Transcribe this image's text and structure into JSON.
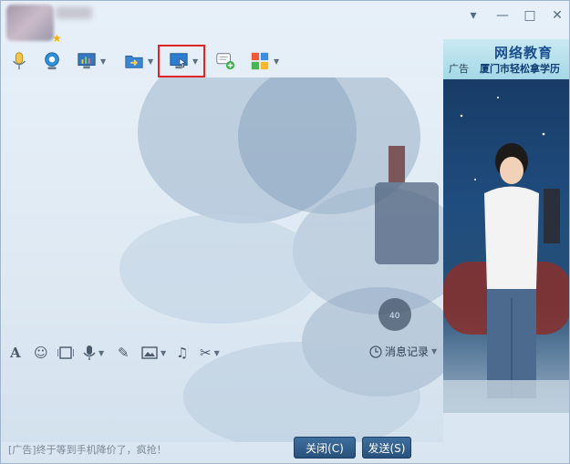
{
  "title_bar": {
    "buttons": {
      "minimize": "—",
      "maximize": "□",
      "close": "✕",
      "menu": "▾"
    }
  },
  "toolbar": {
    "items": [
      {
        "name": "voice-call",
        "icon": "microphone-icon"
      },
      {
        "name": "video-call",
        "icon": "webcam-icon"
      },
      {
        "name": "remote-desktop",
        "icon": "monitor-chart-icon"
      },
      {
        "name": "send-file",
        "icon": "folder-arrow-icon"
      },
      {
        "name": "screen-share",
        "icon": "screen-cursor-icon",
        "highlighted": true
      },
      {
        "name": "create-discussion",
        "icon": "chat-add-icon"
      },
      {
        "name": "apps",
        "icon": "app-grid-icon"
      }
    ]
  },
  "ad_panel": {
    "tag": "广告",
    "title": "网络教育",
    "subtitle": "厦门市轻松拿学历"
  },
  "format_bar": {
    "items": [
      "font-icon",
      "emoji-icon",
      "gif-icon",
      "voice-message-icon",
      "edit-icon",
      "image-icon",
      "music-icon",
      "scissors-icon"
    ],
    "history_label": "消息记录"
  },
  "footer": {
    "ad_text": "[广告]终于等到手机降价了，疯抢！",
    "close_label": "关闭(C)",
    "send_label": "发送(S)"
  },
  "colors": {
    "highlight": "#e12424",
    "button": "#2f5d8c"
  }
}
